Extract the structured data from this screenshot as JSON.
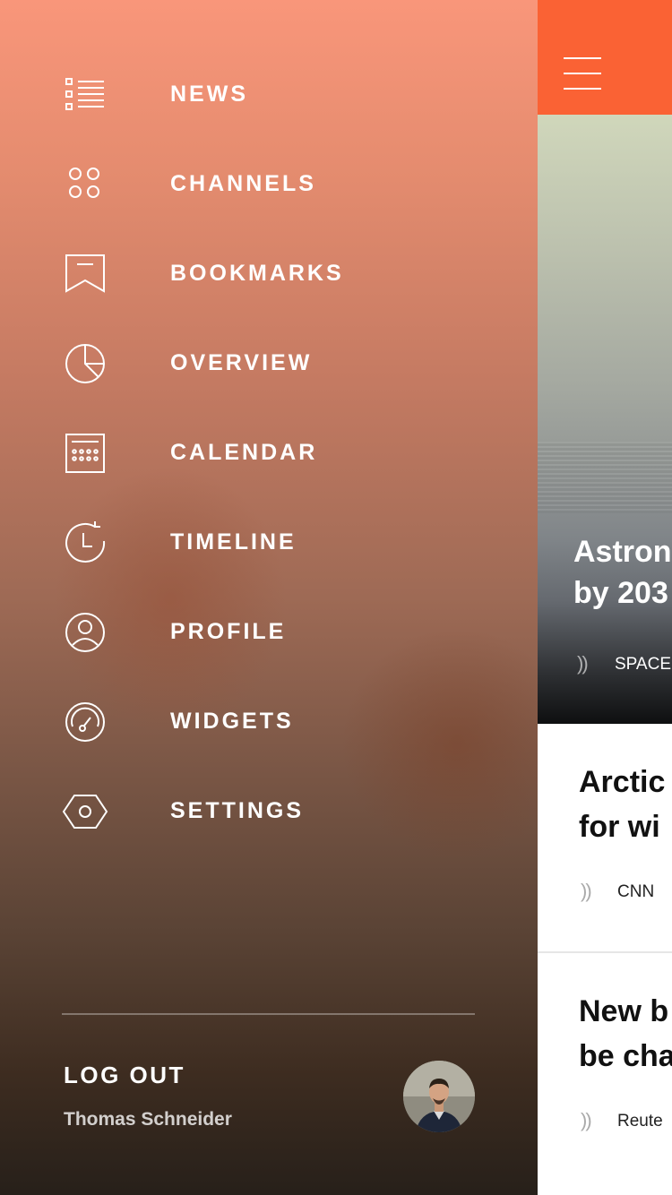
{
  "sidebar": {
    "items": [
      {
        "label": "NEWS",
        "icon": "news-list-icon"
      },
      {
        "label": "CHANNELS",
        "icon": "channels-grid-icon"
      },
      {
        "label": "BOOKMARKS",
        "icon": "bookmark-icon"
      },
      {
        "label": "OVERVIEW",
        "icon": "pie-chart-icon"
      },
      {
        "label": "CALENDAR",
        "icon": "calendar-icon"
      },
      {
        "label": "TIMELINE",
        "icon": "clock-history-icon"
      },
      {
        "label": "PROFILE",
        "icon": "user-icon"
      },
      {
        "label": "WIDGETS",
        "icon": "gauge-icon"
      },
      {
        "label": "SETTINGS",
        "icon": "hexagon-settings-icon"
      }
    ],
    "footer": {
      "logout_label": "LOG OUT",
      "user_name": "Thomas Schneider"
    }
  },
  "main": {
    "accent_color": "#fa6234",
    "hero": {
      "title_line1": "Astron",
      "title_line2": "by 203",
      "source": "SPACE"
    },
    "cards": [
      {
        "title_line1": "Arctic",
        "title_line2": "for wi",
        "source": "CNN"
      },
      {
        "title_line1": "New b",
        "title_line2": "be cha",
        "source": "Reute"
      }
    ]
  }
}
